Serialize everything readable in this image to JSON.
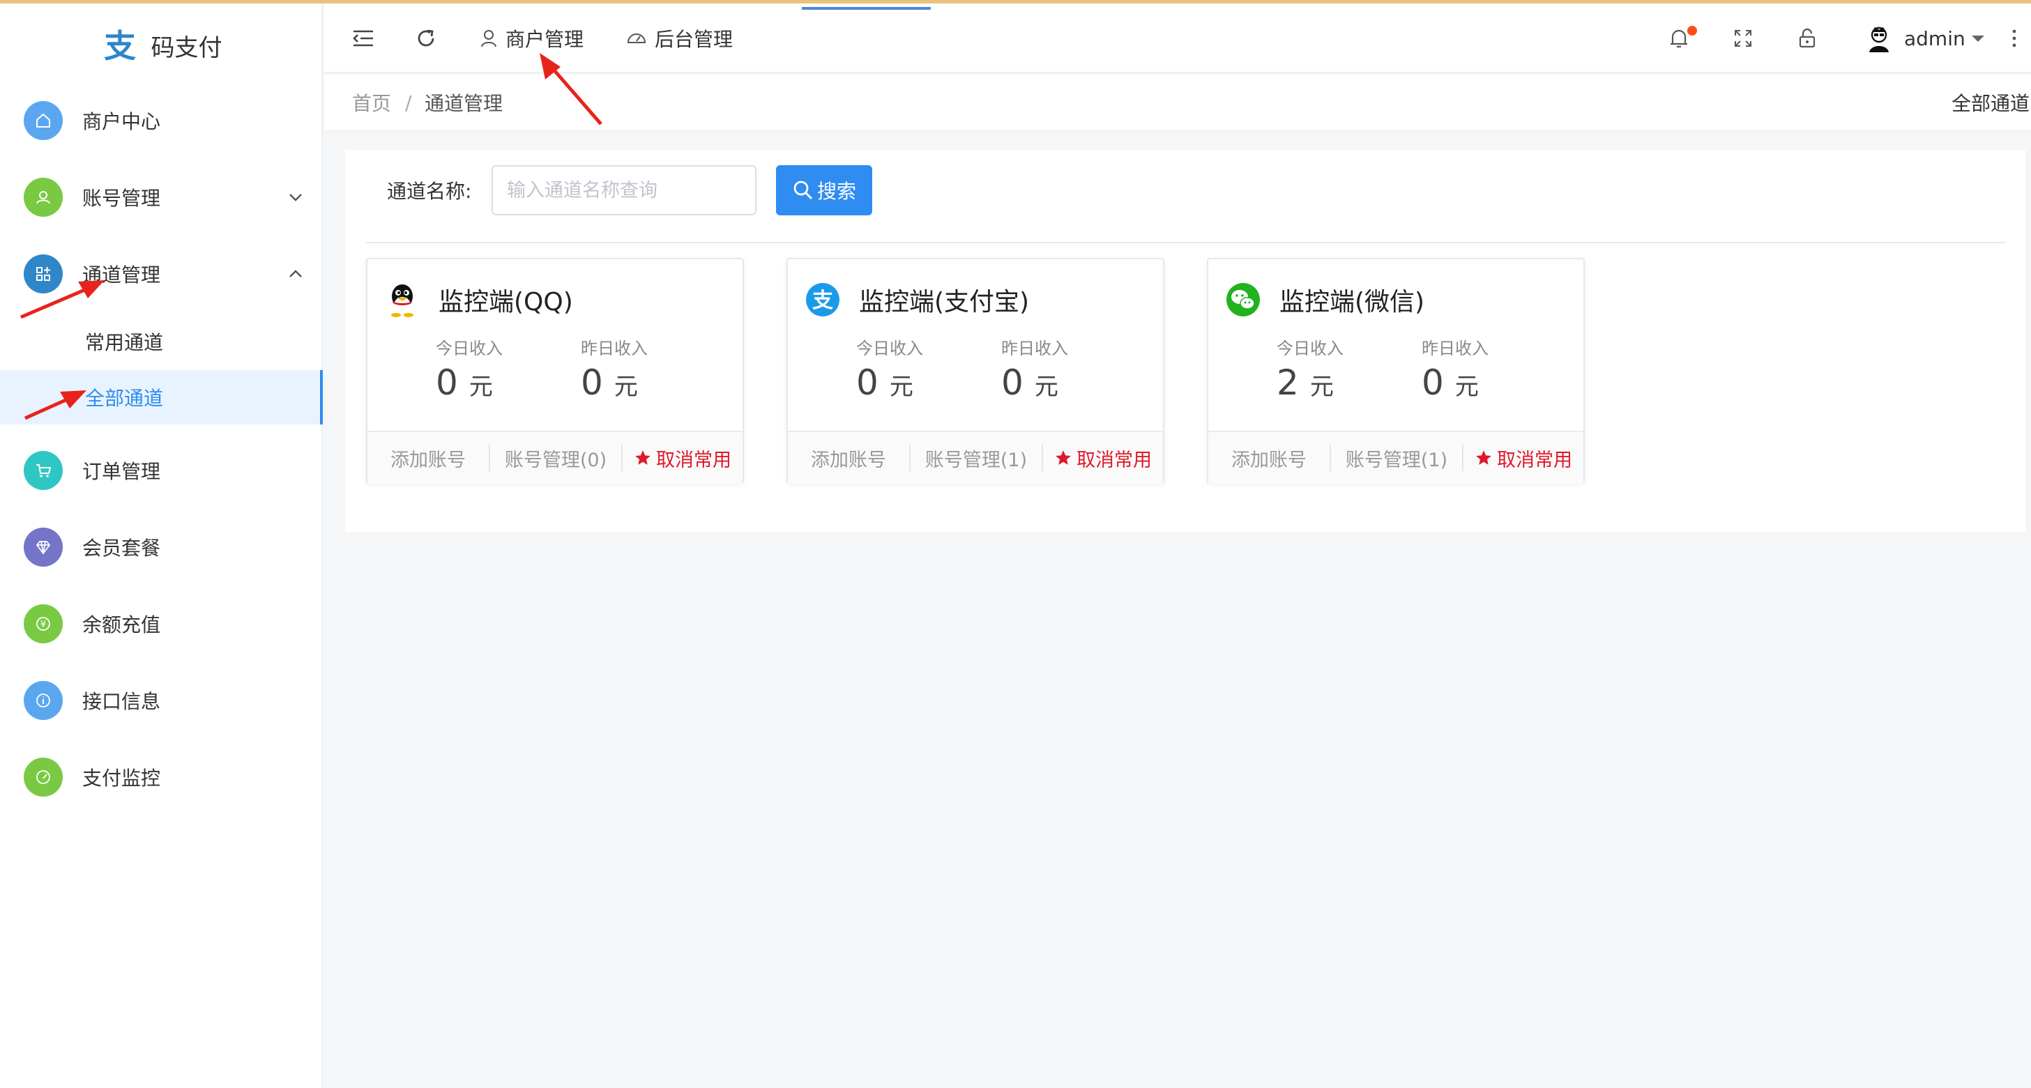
{
  "app": {
    "name": "码支付"
  },
  "sidebar": {
    "items": [
      {
        "label": "商户中心",
        "icon": "home-icon",
        "color": "#5aa7f0"
      },
      {
        "label": "账号管理",
        "icon": "user-icon",
        "color": "#7ac943"
      },
      {
        "label": "通道管理",
        "icon": "apps-icon",
        "color": "#2f86c9"
      },
      {
        "label": "订单管理",
        "icon": "cart-icon",
        "color": "#2fc7c3"
      },
      {
        "label": "会员套餐",
        "icon": "diamond-icon",
        "color": "#7474c9"
      },
      {
        "label": "余额充值",
        "icon": "yen-icon",
        "color": "#7ac943"
      },
      {
        "label": "接口信息",
        "icon": "info-icon",
        "color": "#5aa7f0"
      },
      {
        "label": "支付监控",
        "icon": "gauge-icon",
        "color": "#7ac943"
      }
    ],
    "subitems": [
      {
        "label": "常用通道"
      },
      {
        "label": "全部通道"
      }
    ]
  },
  "header": {
    "tabs": [
      {
        "label": "商户管理"
      },
      {
        "label": "后台管理"
      }
    ],
    "user": "admin"
  },
  "breadcrumb": {
    "home": "首页",
    "sep": "/",
    "current": "通道管理",
    "right": "全部通道"
  },
  "search": {
    "label": "通道名称:",
    "placeholder": "输入通道名称查询",
    "button": "搜索"
  },
  "channels": [
    {
      "title": "监控端(QQ)",
      "icon": "qq-icon",
      "today_label": "今日收入",
      "today": "0",
      "yesterday_label": "昨日收入",
      "yesterday": "0",
      "unit": "元",
      "add": "添加账号",
      "manage": "账号管理(0)",
      "fav": "取消常用"
    },
    {
      "title": "监控端(支付宝)",
      "icon": "alipay-icon",
      "today_label": "今日收入",
      "today": "0",
      "yesterday_label": "昨日收入",
      "yesterday": "0",
      "unit": "元",
      "add": "添加账号",
      "manage": "账号管理(1)",
      "fav": "取消常用"
    },
    {
      "title": "监控端(微信)",
      "icon": "wechat-icon",
      "today_label": "今日收入",
      "today": "2",
      "yesterday_label": "昨日收入",
      "yesterday": "0",
      "unit": "元",
      "add": "添加账号",
      "manage": "账号管理(1)",
      "fav": "取消常用"
    }
  ],
  "colors": {
    "accent": "#2f8cf0",
    "fav": "#e0192a",
    "annotation": "#e8231b"
  }
}
